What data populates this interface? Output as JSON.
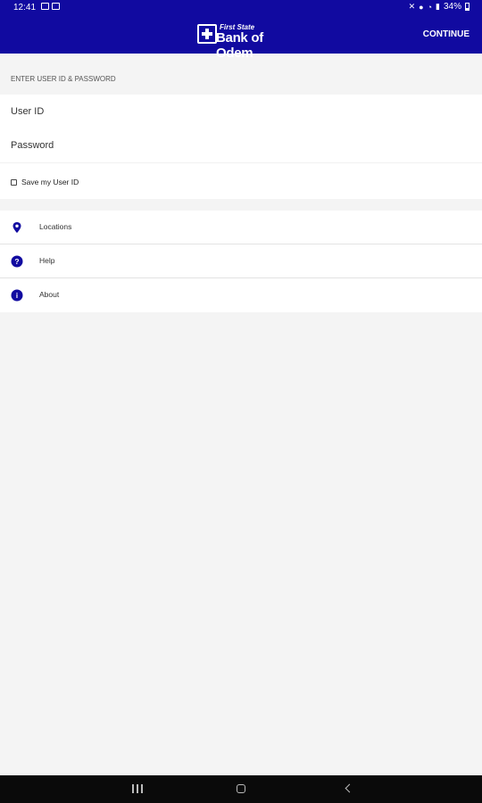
{
  "status_bar": {
    "time": "12:41",
    "battery": "34%"
  },
  "app_bar": {
    "logo_top": "First State",
    "logo_bottom": "Bank of Odem",
    "continue_label": "CONTINUE"
  },
  "login": {
    "section_header": "ENTER USER ID & PASSWORD",
    "user_id_placeholder": "User ID",
    "password_placeholder": "Password",
    "save_user_id_label": "Save my User ID",
    "save_user_id_checked": false
  },
  "menu": {
    "items": [
      {
        "label": "Locations",
        "icon": "location-pin-icon"
      },
      {
        "label": "Help",
        "icon": "help-icon"
      },
      {
        "label": "About",
        "icon": "info-icon"
      }
    ]
  },
  "colors": {
    "brand": "#110aa0",
    "icon": "#110aa0",
    "background": "#f4f4f4"
  }
}
